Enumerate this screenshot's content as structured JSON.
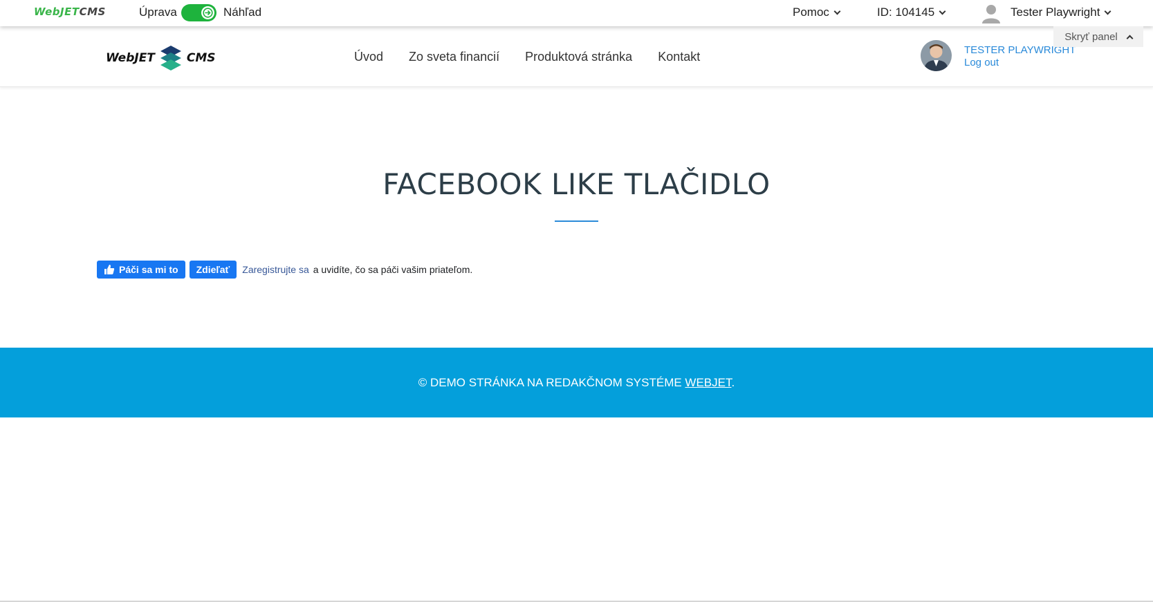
{
  "admin_bar": {
    "logo_part1": "Web",
    "logo_part2": "JET",
    "logo_part3": "CMS",
    "mode_edit": "Úprava",
    "mode_preview": "Náhľad",
    "help": "Pomoc",
    "doc_id": "ID: 104145",
    "user": "Tester Playwright",
    "hide_panel": "Skryť panel",
    "toggle_color": "#1eb33d"
  },
  "site_header": {
    "logo_left": "WebJET",
    "logo_right": "CMS",
    "nav": [
      "Úvod",
      "Zo sveta financií",
      "Produktová stránka",
      "Kontakt"
    ],
    "user_name": "TESTER PLAYWRIGHT",
    "logout": "Log out"
  },
  "main": {
    "title": "FACEBOOK LIKE TLAČIDLO",
    "fb": {
      "like_label": "Páči sa mi to",
      "share_label": "Zdieľať",
      "register_link": "Zaregistrujte sa",
      "register_text": "a uvidíte, čo sa páči vašim priateľom.",
      "button_color": "#1877f2"
    }
  },
  "footer": {
    "text": "© DEMO STRÁNKA NA REDAKČNOM SYSTÉME ",
    "link": "WEBJET",
    "suffix": ".",
    "background": "#049fdb"
  }
}
